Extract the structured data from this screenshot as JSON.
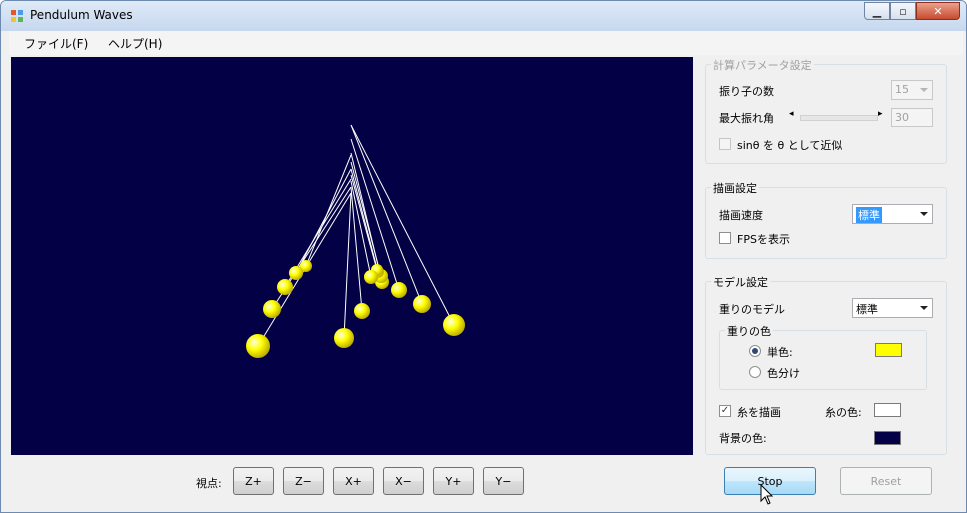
{
  "window": {
    "title": "Pendulum Waves"
  },
  "menu": [
    {
      "label": "ファイル(F)"
    },
    {
      "label": "ヘルプ(H)"
    }
  ],
  "calc_settings": {
    "title": "計算パラメータ設定",
    "count_label": "振り子の数",
    "count_value": "15",
    "max_angle_label": "最大振れ角",
    "max_angle_value": "30",
    "sin_approx_label": "sinθ を θ として近似"
  },
  "draw_settings": {
    "title": "描画設定",
    "speed_label": "描画速度",
    "speed_value": "標準",
    "fps_label": "FPSを表示"
  },
  "model_settings": {
    "title": "モデル設定",
    "weight_model_label": "重りのモデル",
    "weight_model_value": "標準",
    "weight_color_title": "重りの色",
    "single_color_label": "単色:",
    "multi_color_label": "色分け",
    "draw_string_label": "糸を描画",
    "string_color_label": "糸の色:",
    "bg_color_label": "背景の色:"
  },
  "colors": {
    "background": "#030046",
    "weight": "#ffff00",
    "string": "#ffffff"
  },
  "viewpoint": {
    "label": "視点:",
    "buttons": [
      "Z+",
      "Z−",
      "X+",
      "X−",
      "Y+",
      "Y−"
    ]
  },
  "actions": {
    "stop": "Stop",
    "reset": "Reset"
  }
}
